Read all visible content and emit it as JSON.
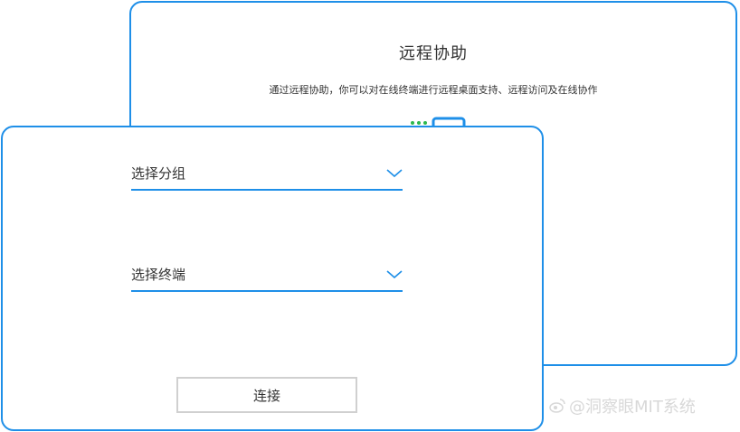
{
  "background_panel": {
    "title": "远程协助",
    "description": "通过远程协助，你可以对在线终端进行远程桌面支持、远程访问及在线协作",
    "icon": "remote-desktop-icon"
  },
  "form": {
    "group_select": {
      "label": "选择分组",
      "icon": "chevron-down-icon"
    },
    "terminal_select": {
      "label": "选择终端",
      "icon": "chevron-down-icon"
    },
    "connect_button": {
      "label": "连接"
    }
  },
  "watermark": {
    "text": "@洞察眼MIT系统",
    "icon": "weibo-icon"
  },
  "colors": {
    "accent": "#1e8fe8",
    "icon_green": "#2db84d",
    "button_border": "#d0d0d0",
    "text": "#333333"
  }
}
